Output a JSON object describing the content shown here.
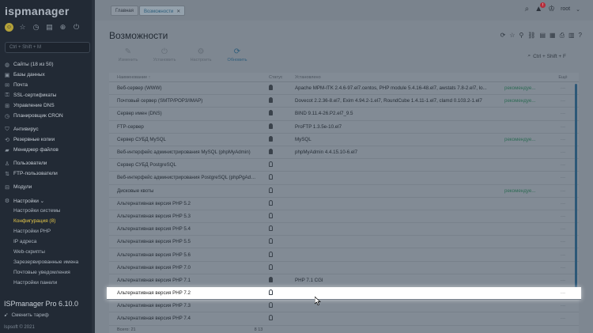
{
  "app": {
    "logo": "ispmanager",
    "footer_title": "ISPmanager Pro 6.10.0",
    "tariff_label": "Сменить тариф",
    "copyright": "Ispsoft © 2021"
  },
  "sidebar": {
    "search_placeholder": "Ctrl + Shift + M",
    "items": [
      {
        "label": "Сайты (18 из 50)",
        "icon": "globe-icon"
      },
      {
        "label": "Базы данных",
        "icon": "database-icon"
      },
      {
        "label": "Почта",
        "icon": "mail-icon"
      },
      {
        "label": "SSL-сертификаты",
        "icon": "lock-icon"
      },
      {
        "label": "Управление DNS",
        "icon": "dns-icon"
      },
      {
        "label": "Планировщик CRON",
        "icon": "clock-icon"
      },
      {
        "label": "Антивирус",
        "icon": "shield-icon"
      },
      {
        "label": "Резервные копии",
        "icon": "backup-icon"
      },
      {
        "label": "Менеджер файлов",
        "icon": "folder-icon"
      },
      {
        "label": "Пользователи",
        "icon": "user-icon"
      },
      {
        "label": "FTP-пользователи",
        "icon": "ftp-icon"
      },
      {
        "label": "Модули",
        "icon": "modules-icon"
      },
      {
        "label": "Настройки ⌄",
        "icon": "gear-icon"
      }
    ],
    "sub_items": [
      {
        "label": "Настройки системы"
      },
      {
        "label": "Конфигурация (8)"
      },
      {
        "label": "Настройки PHP"
      },
      {
        "label": "IP адреса"
      },
      {
        "label": "Web-скрипты"
      },
      {
        "label": "Зарезервированные имена"
      },
      {
        "label": "Почтовые уведомления"
      },
      {
        "label": "Настройки панели"
      }
    ]
  },
  "topbar": {
    "breadcrumbs": [
      {
        "label": "Главная"
      },
      {
        "label": "Возможности",
        "close": "✕"
      }
    ],
    "user": "root"
  },
  "page": {
    "title": "Возможности",
    "toolbar": [
      {
        "label": "Изменить",
        "icon": "edit-icon",
        "enabled": false
      },
      {
        "label": "Установить",
        "icon": "install-icon",
        "enabled": false
      },
      {
        "label": "Настроить",
        "icon": "configure-icon",
        "enabled": false
      },
      {
        "label": "Обновить",
        "icon": "refresh-icon",
        "enabled": true
      }
    ],
    "search_shortcut": "Ctrl + Shift + F",
    "columns": {
      "name": "Наименование ↑",
      "status": "Статус",
      "version": "Установлено",
      "extra": "Ещё"
    },
    "rows": [
      {
        "name": "Веб-сервер (WWW)",
        "on": true,
        "version": "Apache MPM-ITK 2.4.6-97.el7.centos, PHP module 5.4.16-48.el7, awstats 7.8-2.el7, lo...",
        "rec": "рекомендуе..."
      },
      {
        "name": "Почтовый сервер (SMTP/POP3/IMAP)",
        "on": true,
        "version": "Dovecot 2.2.36-8.el7, Exim 4.94.2-1.el7, RoundCube 1.4.11-1.el7, clamd 0.103.2-1.el7",
        "rec": "рекомендуе..."
      },
      {
        "name": "Сервер имен (DNS)",
        "on": true,
        "version": "BIND 9.11.4-26.P2.el7_9.5",
        "rec": ""
      },
      {
        "name": "FTP-сервер",
        "on": true,
        "version": "ProFTP 1.3.5e-10.el7",
        "rec": ""
      },
      {
        "name": "Сервер СУБД MySQL",
        "on": true,
        "version": "MySQL",
        "rec": "рекомендуе..."
      },
      {
        "name": "Веб-интерфейс администрирования MySQL (phpMyAdmin)",
        "on": true,
        "version": "phpMyAdmin 4.4.15.10-6.el7",
        "rec": ""
      },
      {
        "name": "Сервер СУБД PostgreSQL",
        "on": false,
        "version": "",
        "rec": ""
      },
      {
        "name": "Веб-интерфейс администрирования PostgreSQL (phpPgAdmin)",
        "on": false,
        "version": "",
        "rec": ""
      },
      {
        "name": "Дисковые квоты",
        "on": false,
        "version": "",
        "rec": "рекомендуе..."
      },
      {
        "name": "Альтернативная версия PHP 5.2",
        "on": false,
        "version": "",
        "rec": ""
      },
      {
        "name": "Альтернативная версия PHP 5.3",
        "on": false,
        "version": "",
        "rec": ""
      },
      {
        "name": "Альтернативная версия PHP 5.4",
        "on": false,
        "version": "",
        "rec": ""
      },
      {
        "name": "Альтернативная версия PHP 5.5",
        "on": false,
        "version": "",
        "rec": ""
      },
      {
        "name": "Альтернативная версия PHP 5.6",
        "on": false,
        "version": "",
        "rec": ""
      },
      {
        "name": "Альтернативная версия PHP 7.0",
        "on": false,
        "version": "",
        "rec": ""
      },
      {
        "name": "Альтернативная версия PHP 7.1",
        "on": true,
        "version": "PHP 7.1 CGI",
        "rec": ""
      },
      {
        "name": "Альтернативная версия PHP 7.2",
        "on": false,
        "version": "",
        "rec": "",
        "highlight": true
      },
      {
        "name": "Альтернативная версия PHP 7.3",
        "on": false,
        "version": "",
        "rec": ""
      },
      {
        "name": "Альтернативная версия PHP 7.4",
        "on": false,
        "version": "",
        "rec": ""
      }
    ],
    "more": "···",
    "footer_total": "Всего: 21",
    "footer_counts": "8   13"
  }
}
